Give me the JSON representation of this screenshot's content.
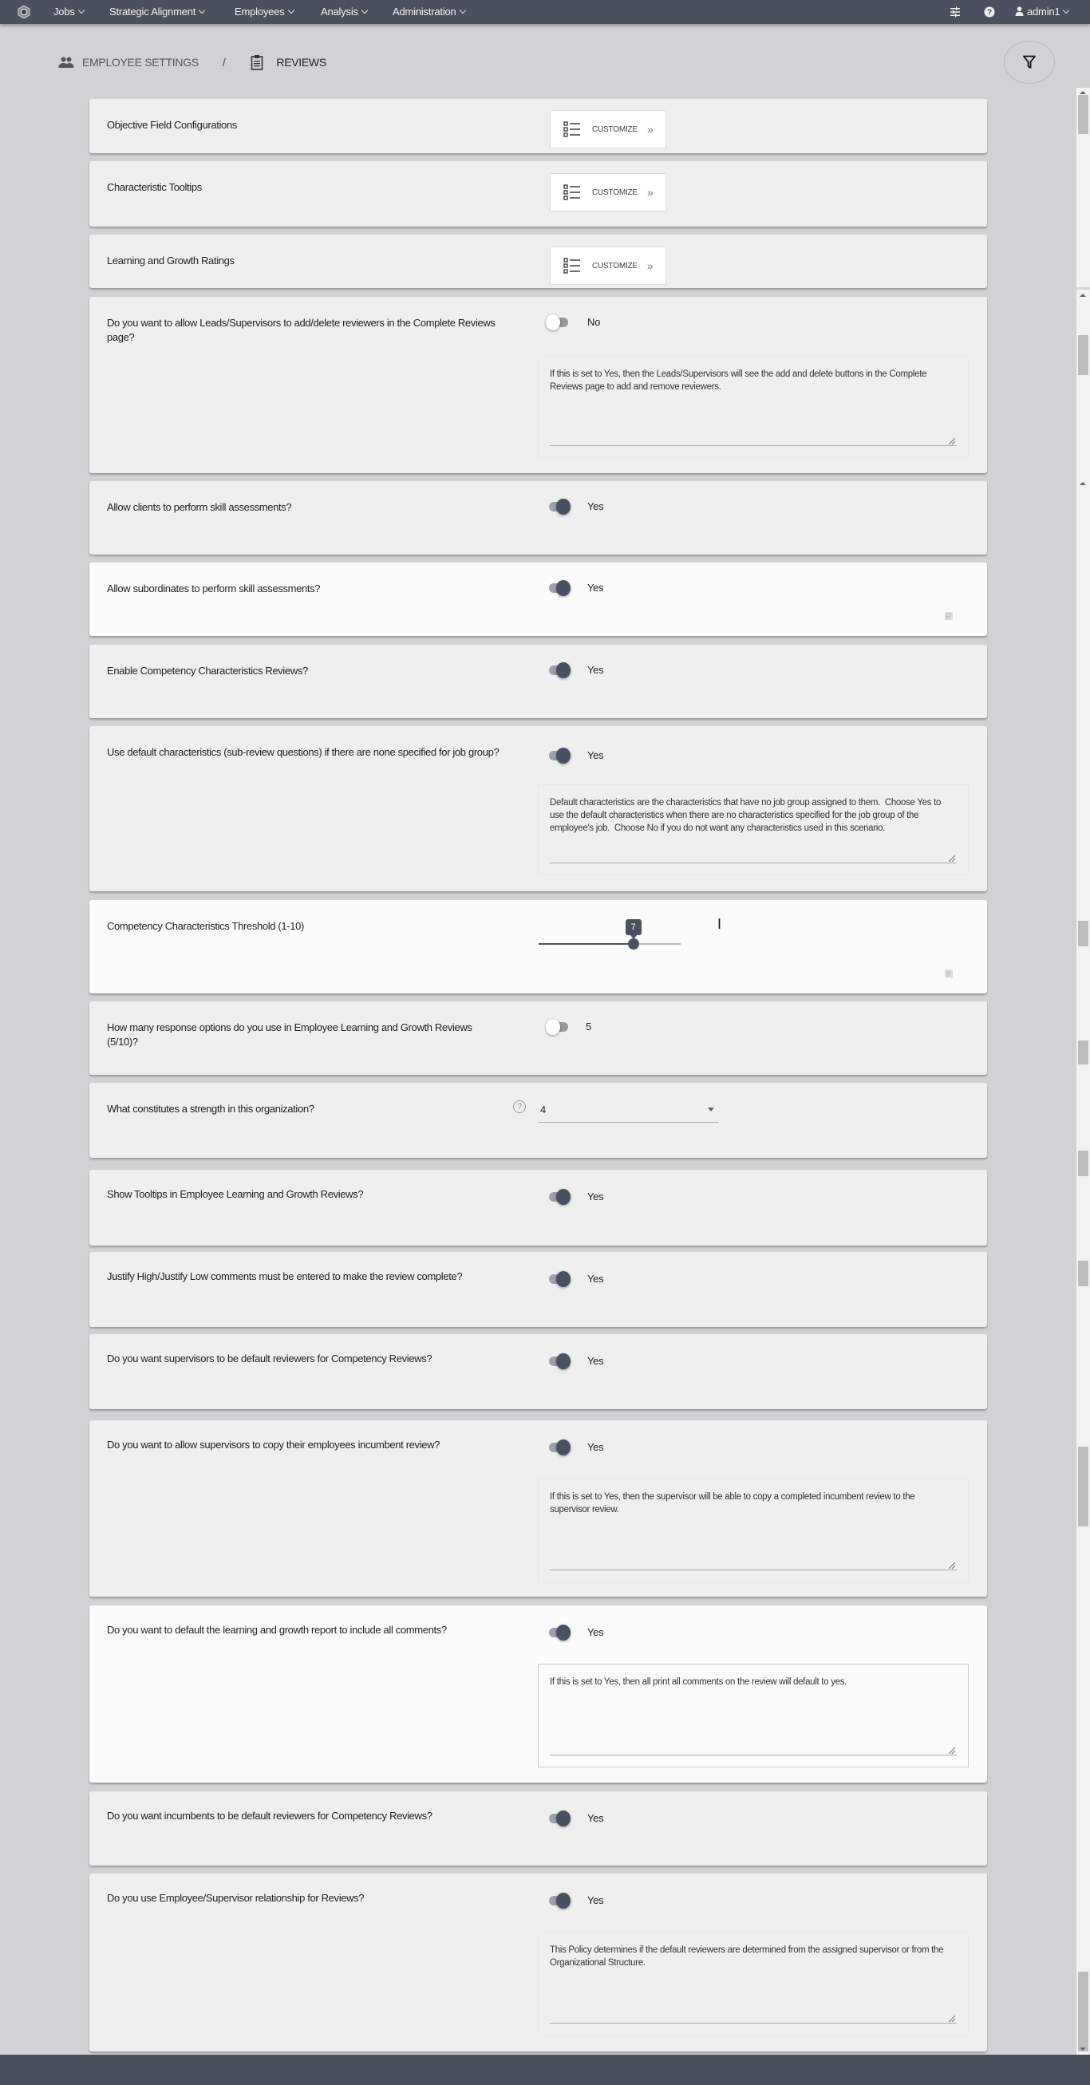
{
  "nav": {
    "items": [
      {
        "label": "Jobs"
      },
      {
        "label": "Strategic Alignment"
      },
      {
        "label": "Employees"
      },
      {
        "label": "Analysis"
      },
      {
        "label": "Administration"
      }
    ],
    "user": "admin1",
    "icons": [
      "settings-sliders-icon",
      "help-icon",
      "user-icon"
    ]
  },
  "breadcrumb": {
    "parent": "EMPLOYEE SETTINGS",
    "separator": "/",
    "current": "REVIEWS"
  },
  "colors": {
    "nav_bg": "#4a5060",
    "accent": "#4a5060",
    "page_bg": "#d1d2d4",
    "card_bg": "#efefef"
  },
  "settings": [
    {
      "label": "Objective Field Configurations",
      "type": "customize",
      "button": "CUSTOMIZE"
    },
    {
      "label": "Characteristic Tooltips",
      "type": "customize",
      "button": "CUSTOMIZE"
    },
    {
      "label": "Learning and Growth Ratings",
      "type": "customize",
      "button": "CUSTOMIZE"
    },
    {
      "label": "Do you want to allow Leads/Supervisors to add/delete reviewers in the Complete Reviews page?",
      "type": "toggle",
      "checked": false,
      "value_label": "No",
      "help": "If this is set to Yes, then the Leads/Supervisors will see the add and delete buttons in the Complete Reviews page to add and remove reviewers."
    },
    {
      "label": "Allow clients to perform skill assessments?",
      "type": "toggle",
      "checked": true,
      "value_label": "Yes"
    },
    {
      "label": "Allow subordinates to perform skill assessments?",
      "type": "toggle",
      "checked": true,
      "value_label": "Yes"
    },
    {
      "label": "Enable Competency Characteristics Reviews?",
      "type": "toggle",
      "checked": true,
      "value_label": "Yes"
    },
    {
      "label": "Use default characteristics (sub-review questions) if there are none specified for job group?",
      "type": "toggle",
      "checked": true,
      "value_label": "Yes",
      "help": "Default characteristics are the characteristics that have no job group assigned to them.  Choose Yes to use the default characteristics when there are no characteristics specified for the job group of the employee's job.  Choose No if you do not want any characteristics used in this scenario."
    },
    {
      "label": "Competency Characteristics Threshold (1-10)",
      "type": "slider",
      "value": 7,
      "min": 1,
      "max": 10
    },
    {
      "label": "How many response options do you use in Employee Learning and Growth Reviews (5/10)?",
      "type": "toggle",
      "checked": false,
      "value_label": "5"
    },
    {
      "label": "What constitutes a strength in this organization?",
      "type": "select",
      "value": "4"
    },
    {
      "label": "Show Tooltips in Employee Learning and Growth Reviews?",
      "type": "toggle",
      "checked": true,
      "value_label": "Yes"
    },
    {
      "label": "Justify High/Justify Low comments must be entered to make the review complete?",
      "type": "toggle",
      "checked": true,
      "value_label": "Yes"
    },
    {
      "label": "Do you want supervisors to be default reviewers for Competency Reviews?",
      "type": "toggle",
      "checked": true,
      "value_label": "Yes"
    },
    {
      "label": "Do you want to allow supervisors to copy their employees incumbent review?",
      "type": "toggle",
      "checked": true,
      "value_label": "Yes",
      "help": "If this is set to Yes, then the supervisor will be able to copy a completed incumbent review to the supervisor review."
    },
    {
      "label": "Do you want to default the learning and growth report to include all comments?",
      "type": "toggle",
      "checked": true,
      "value_label": "Yes",
      "help": "If this is set to Yes, then all print all comments on the review will default to yes."
    },
    {
      "label": "Do you want incumbents to be default reviewers for Competency Reviews?",
      "type": "toggle",
      "checked": true,
      "value_label": "Yes"
    },
    {
      "label": "Do you use Employee/Supervisor relationship for Reviews?",
      "type": "toggle",
      "checked": true,
      "value_label": "Yes",
      "help": "This Policy determines if the default reviewers are determined from the assigned supervisor or from the Organizational Structure."
    }
  ]
}
